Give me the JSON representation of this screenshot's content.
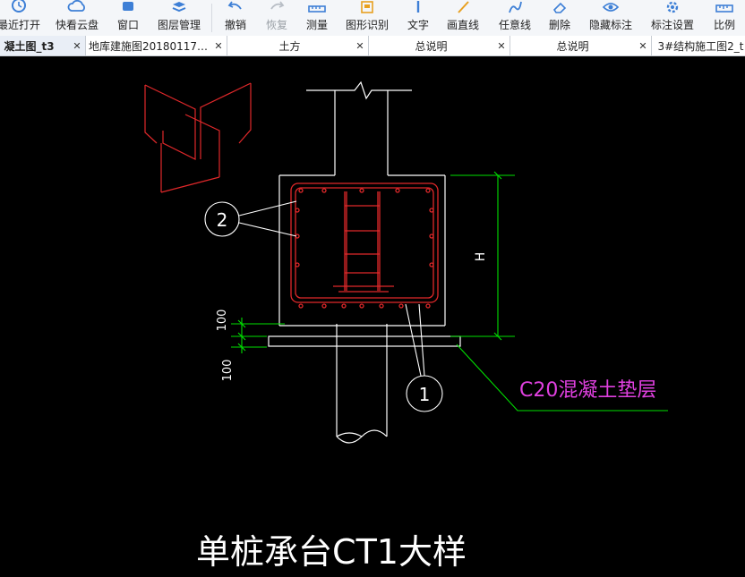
{
  "toolbar": {
    "items": [
      {
        "label": "最近打开",
        "icon": "clock-icon"
      },
      {
        "label": "快看云盘",
        "icon": "cloud-icon"
      },
      {
        "label": "窗口",
        "icon": "window-icon"
      },
      {
        "label": "图层管理",
        "icon": "layers-icon"
      },
      {
        "label": "撤销",
        "icon": "undo-icon"
      },
      {
        "label": "恢复",
        "icon": "redo-icon",
        "disabled": true
      },
      {
        "label": "测量",
        "icon": "ruler-icon"
      },
      {
        "label": "图形识别",
        "icon": "shape-recognize-icon"
      },
      {
        "label": "文字",
        "icon": "text-icon"
      },
      {
        "label": "画直线",
        "icon": "line-icon"
      },
      {
        "label": "任意线",
        "icon": "freehand-line-icon"
      },
      {
        "label": "删除",
        "icon": "eraser-icon"
      },
      {
        "label": "隐藏标注",
        "icon": "eye-icon"
      },
      {
        "label": "标注设置",
        "icon": "gear-icon"
      },
      {
        "label": "比例",
        "icon": "scale-icon"
      }
    ],
    "accent": "#3d7fd6"
  },
  "tabs": [
    {
      "label": "凝土图_t3",
      "active": true
    },
    {
      "label": "地库建施图20180117…"
    },
    {
      "label": "土方"
    },
    {
      "label": "总说明"
    },
    {
      "label": "总说明"
    },
    {
      "label": "3#结构施工图2_t"
    }
  ],
  "drawing": {
    "title": "单桩承台CT1大样",
    "label_concrete": "C20混凝土垫层",
    "dim_height": "H",
    "dim_100_top": "100",
    "dim_100_bottom": "100",
    "callout_1": "1",
    "callout_2": "2",
    "colors": {
      "background": "#000000",
      "outline": "#ffffff",
      "rebar": "#e0282a",
      "dimension": "#00e000",
      "annotation": "#e040e0"
    }
  }
}
